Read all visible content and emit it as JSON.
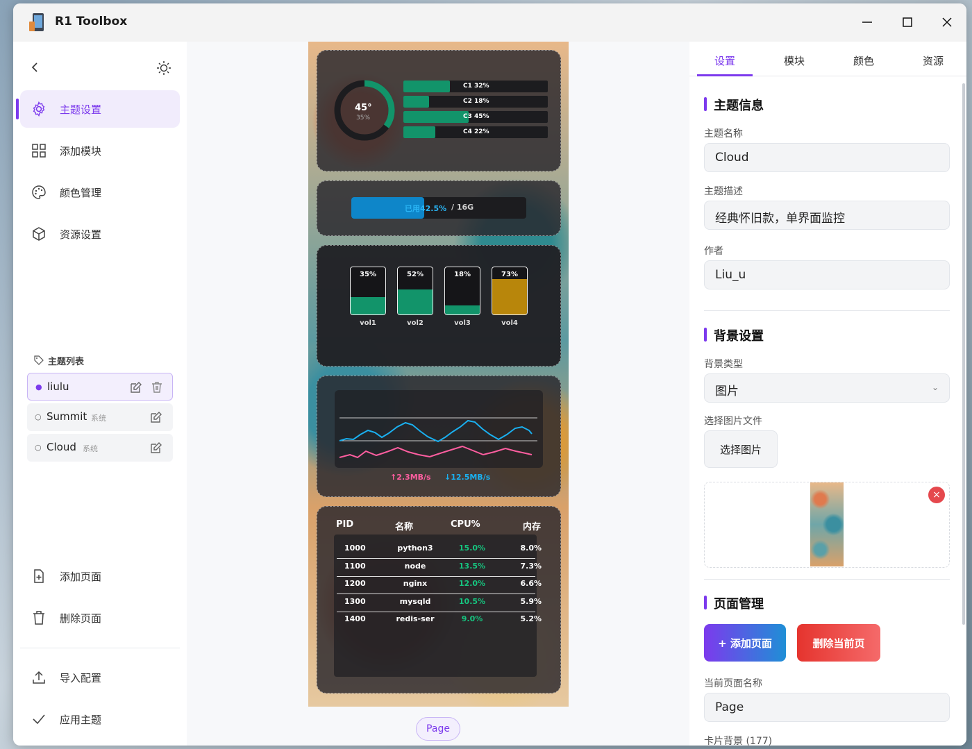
{
  "app": {
    "title": "R1 Toolbox"
  },
  "sidebar": {
    "nav": [
      {
        "label": "主题设置",
        "icon": "gear-icon"
      },
      {
        "label": "添加模块",
        "icon": "grid-icon"
      },
      {
        "label": "颜色管理",
        "icon": "palette-icon"
      },
      {
        "label": "资源设置",
        "icon": "cube-icon"
      }
    ],
    "theme_list_title": "主题列表",
    "themes": [
      {
        "name": "liulu",
        "tag": ""
      },
      {
        "name": "Summit",
        "tag": "系统"
      },
      {
        "name": "Cloud",
        "tag": "系统"
      }
    ],
    "add_page": "添加页面",
    "delete_page": "删除页面",
    "import_config": "导入配置",
    "apply_theme": "应用主题"
  },
  "preview": {
    "cpu": {
      "temp": "45°",
      "usage": "35%",
      "cores": [
        "C1 32%",
        "C2 18%",
        "C3 45%",
        "C4 22%"
      ],
      "core_values": [
        0.32,
        0.18,
        0.45,
        0.22
      ]
    },
    "memory": {
      "used_label": "已用42.5%",
      "total": "/ 16G",
      "fraction": 0.425
    },
    "volumes": [
      {
        "name": "vol1",
        "pct": "35%",
        "value": 0.35,
        "color": "#12946a"
      },
      {
        "name": "vol2",
        "pct": "52%",
        "value": 0.52,
        "color": "#12946a"
      },
      {
        "name": "vol3",
        "pct": "18%",
        "value": 0.18,
        "color": "#12946a"
      },
      {
        "name": "vol4",
        "pct": "73%",
        "value": 0.73,
        "color": "#b8860b"
      }
    ],
    "network": {
      "up": "↑2.3MB/s",
      "down": "↓12.5MB/s",
      "up_color": "#ff5ea0",
      "down_color": "#1ab0f0"
    },
    "process_table": {
      "headers": [
        "PID",
        "名称",
        "CPU%",
        "内存"
      ],
      "rows": [
        [
          "1000",
          "python3",
          "15.0%",
          "8.0%"
        ],
        [
          "1100",
          "node",
          "13.5%",
          "7.3%"
        ],
        [
          "1200",
          "nginx",
          "12.0%",
          "6.6%"
        ],
        [
          "1300",
          "mysqld",
          "10.5%",
          "5.9%"
        ],
        [
          "1400",
          "redis-ser",
          "9.0%",
          "5.2%"
        ]
      ]
    },
    "page_chip": "Page"
  },
  "panel": {
    "tabs": [
      "设置",
      "模块",
      "颜色",
      "资源"
    ],
    "theme_info_title": "主题信息",
    "theme_name_label": "主题名称",
    "theme_name": "Cloud",
    "theme_desc_label": "主题描述",
    "theme_desc": "经典怀旧款，单界面监控",
    "author_label": "作者",
    "author": "Liu_u",
    "bg_title": "背景设置",
    "bg_type_label": "背景类型",
    "bg_type": "图片",
    "bg_file_label": "选择图片文件",
    "choose_image": "选择图片",
    "page_mgmt_title": "页面管理",
    "add_page_btn": "+ 添加页面",
    "delete_page_btn": "删除当前页",
    "page_name_label": "当前页面名称",
    "page_name": "Page",
    "card_bg_label": "卡片背景 (177)"
  },
  "colors": {
    "accent": "#7c3aed",
    "green": "#12946a",
    "danger": "#e5484d"
  }
}
